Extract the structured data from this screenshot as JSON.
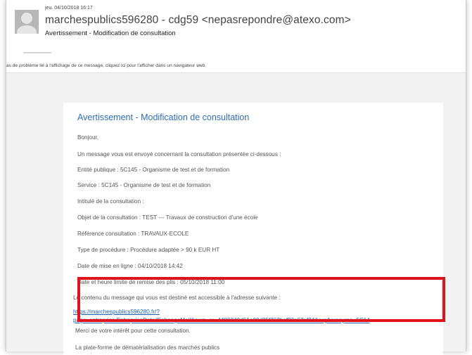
{
  "header": {
    "date": "jeu. 04/10/2018 16:17",
    "sender": "marchespublics596280 - cdg59 <nepasrepondre@atexo.com>",
    "subject": "Avertissement - Modification de consultation"
  },
  "infobar": {
    "text": "as de problème lié à l'affichage de ce message, cliquez ici pour l'afficher dans un navigateur web."
  },
  "email": {
    "title": "Avertissement - Modification de consultation",
    "greeting": "Bonjour,",
    "intro": "Un message vous est envoyé concernant la consultation présentée ci-dessous :",
    "entite": "Entité publique : 5C145 - Organisme de test et de formation",
    "service": "Service : 5C145 - Organisme de test et de formation",
    "intitule": "Intitulé de la consultation :",
    "objet": "Objet de la consultation : TEST --- Travaux de construction d'une école",
    "reference": "Référence consultation : TRAVAUX-ECOLE",
    "procedure": "Type de procédure : Procédure adaptée > 90 k EUR HT",
    "mise_en_ligne": "Date de mise en ligne : 04/10/2018 14:42",
    "limite": "Date et heure limite de remise des plis : 05/10/2018 11:00",
    "contenu": "Le contenu du message qui vous est destiné est accessible à l'adresse suivante :",
    "link_line1": "https://marchespublics596280.fr/?",
    "link_line2": "page=entreprise.EntrepriseDetailEchangeMail&num_ar=4480240d51a00d25f762bcf93c67af24&orgAcronyme=5C14",
    "merci": "Merci de votre intérêt pour cette consultation.",
    "signature": "La plate-forme de dématérialisation des marchés publics"
  },
  "colors": {
    "title_blue": "#2f6db4",
    "link_blue": "#1a5fb4",
    "highlight_red": "#e0121b"
  }
}
